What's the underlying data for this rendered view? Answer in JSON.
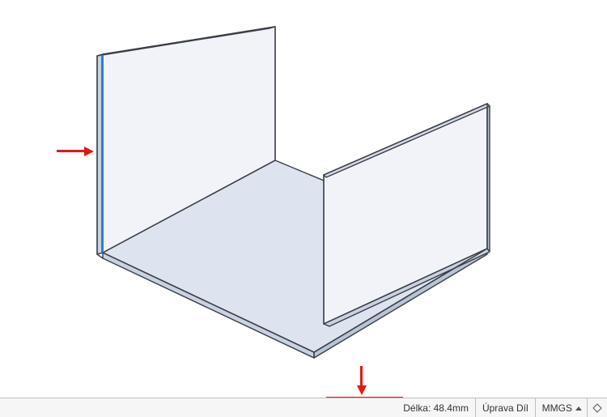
{
  "statusbar": {
    "measurement_label": "Délka: 48.4mm",
    "mode_label": "Úprava Díl",
    "units_label": "MMGS"
  },
  "callouts": {
    "edge_highlight": "selected-edge"
  },
  "model": {
    "description": "sheet-metal-u-channel",
    "faces": {
      "bottom_fill": "#dde4f0",
      "wall_fill": "#eef1f8",
      "stroke": "#3b3f46"
    }
  }
}
